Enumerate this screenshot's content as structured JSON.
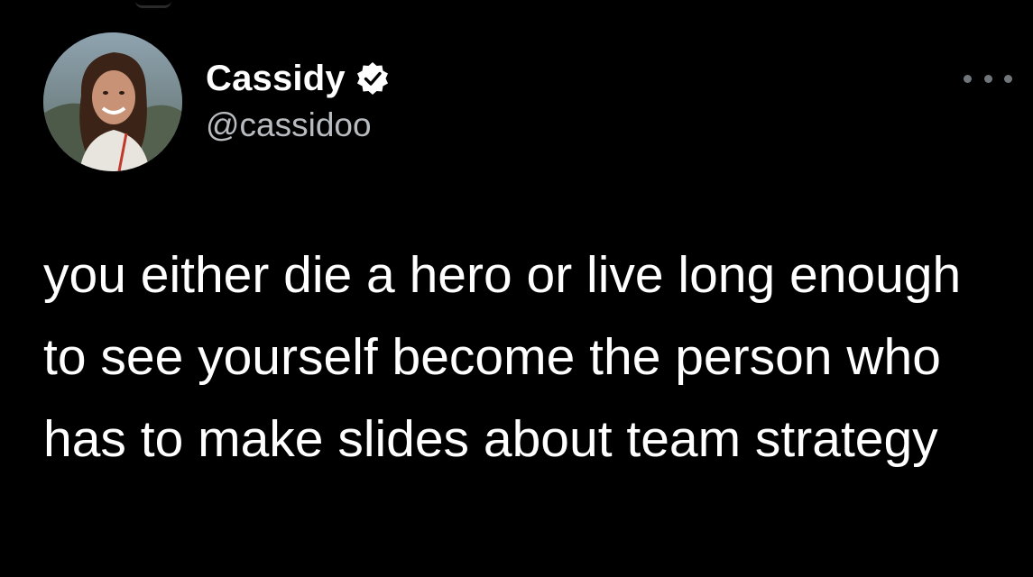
{
  "tweet": {
    "author": {
      "display_name": "Cassidy",
      "handle": "@cassidoo",
      "verified": true,
      "avatar_icon": "profile-photo"
    },
    "menu_icon": "more-horizontal-icon",
    "text": "you either die a hero or live long enough to see yourself become the person who has to make slides about team strategy"
  },
  "colors": {
    "background": "#000000",
    "primary_text": "#ffffff",
    "secondary_text": "#b8bcc0",
    "verified_badge": "#ffffff",
    "verified_check": "#000000"
  }
}
